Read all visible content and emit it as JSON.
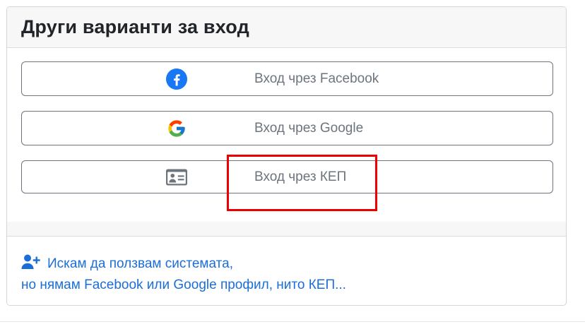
{
  "header": {
    "title": "Други варианти за вход"
  },
  "buttons": {
    "facebook": {
      "label": "Вход чрез Facebook",
      "icon": "facebook-icon"
    },
    "google": {
      "label": "Вход чрез Google",
      "icon": "google-icon"
    },
    "kep": {
      "label": "Вход чрез КЕП",
      "icon": "id-card-icon"
    }
  },
  "register": {
    "icon": "user-plus-icon",
    "line1": "Искам да ползвам системата,",
    "line2": "но нямам Facebook или Google профил, нито КЕП..."
  },
  "colors": {
    "facebook_blue": "#1877f2",
    "link_blue": "#1a6ed8",
    "highlight_red": "#ee0000",
    "button_text": "#6c757d"
  }
}
